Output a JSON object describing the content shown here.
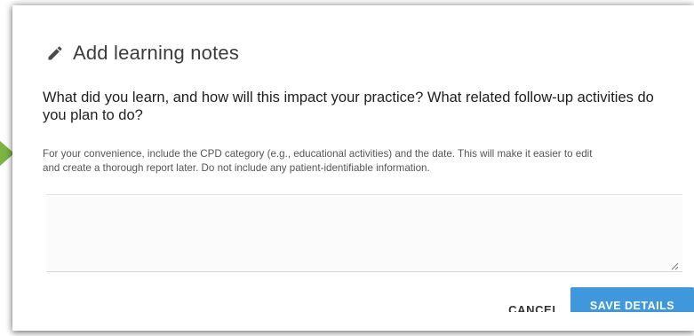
{
  "dialog": {
    "title": "Add learning notes",
    "question_line1": "What did you learn, and how will this impact your practice? What related follow-up activities do",
    "question_line2": "you plan to do?",
    "hint_line1": "For your convenience, include the CPD category (e.g., educational activities) and the date. This will make it easier to edit",
    "hint_line2": "and create a thorough report later. Do not include any patient-identifiable information.",
    "notes_value": "",
    "notes_placeholder": ""
  },
  "actions": {
    "cancel_label": "CANCEL",
    "save_label": "SAVE DETAILS"
  },
  "icons": {
    "title_icon": "pencil-icon",
    "pointer": "pointer-arrow-icon",
    "resize": "resize-grip-icon"
  },
  "colors": {
    "primary": "#3f97dc",
    "pointer_green": "#7cb342",
    "title_text": "#3c3c3c"
  }
}
